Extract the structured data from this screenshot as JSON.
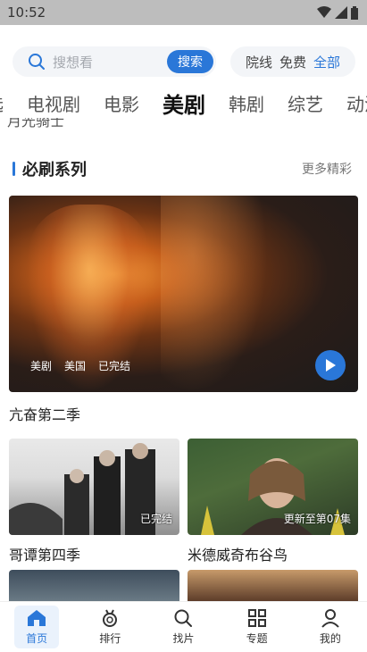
{
  "status": {
    "time": "10:52"
  },
  "search": {
    "placeholder": "搜想看",
    "button_label": "搜索"
  },
  "filters": [
    {
      "label": "院线",
      "active": false
    },
    {
      "label": "免费",
      "active": false
    },
    {
      "label": "全部",
      "active": true
    }
  ],
  "tabs": [
    {
      "label": "选",
      "active": false
    },
    {
      "label": "电视剧",
      "active": false
    },
    {
      "label": "电影",
      "active": false
    },
    {
      "label": "美剧",
      "active": true
    },
    {
      "label": "韩剧",
      "active": false
    },
    {
      "label": "综艺",
      "active": false
    },
    {
      "label": "动漫",
      "active": false
    }
  ],
  "cut_text": "月光骑士",
  "section": {
    "title": "必刷系列",
    "more": "更多精彩"
  },
  "hero": {
    "tags": [
      "美剧",
      "美国",
      "已完结"
    ],
    "title": "亢奋第二季"
  },
  "cards": [
    {
      "title": "哥谭第四季",
      "badge": "已完结"
    },
    {
      "title": "米德威奇布谷鸟",
      "badge": "更新至第07集"
    }
  ],
  "nav": [
    {
      "label": "首页",
      "icon": "home-icon",
      "active": true
    },
    {
      "label": "排行",
      "icon": "medal-icon",
      "active": false
    },
    {
      "label": "找片",
      "icon": "search-icon",
      "active": false
    },
    {
      "label": "专题",
      "icon": "grid-icon",
      "active": false
    },
    {
      "label": "我的",
      "icon": "user-icon",
      "active": false
    }
  ],
  "colors": {
    "accent": "#2a77d8"
  }
}
